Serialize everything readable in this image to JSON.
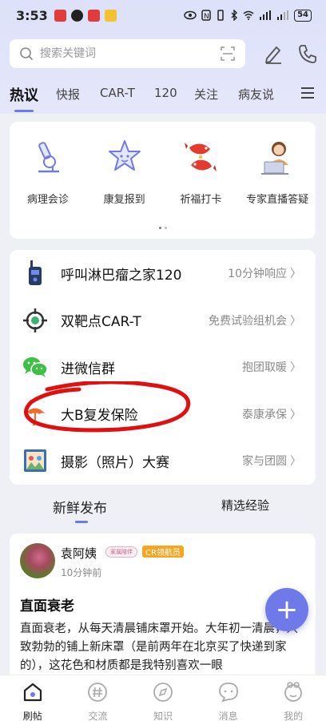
{
  "status_bar": {
    "time": "3:53",
    "battery": "54"
  },
  "search": {
    "placeholder": "搜索关键词"
  },
  "tabs": [
    {
      "label": "热议",
      "active": true
    },
    {
      "label": "快报"
    },
    {
      "label": "CAR-T"
    },
    {
      "label": "120"
    },
    {
      "label": "关注"
    },
    {
      "label": "病友说"
    }
  ],
  "quick_actions": [
    {
      "label": "病理会诊",
      "icon": "microscope-icon"
    },
    {
      "label": "康复报到",
      "icon": "star-face-icon"
    },
    {
      "label": "祈福打卡",
      "icon": "koi-fish-icon"
    },
    {
      "label": "专家直播答疑",
      "icon": "doctor-laptop-icon"
    }
  ],
  "service_list": [
    {
      "title": "呼叫淋巴瘤之家120",
      "subtitle": "10分钟响应",
      "icon": "walkie-talkie-icon"
    },
    {
      "title": "双靶点CAR-T",
      "subtitle": "免费试验组机会",
      "icon": "target-icon"
    },
    {
      "title": "进微信群",
      "subtitle": "抱团取暖",
      "icon": "wechat-icon"
    },
    {
      "title": "大B复发保险",
      "subtitle": "泰康承保",
      "icon": "umbrella-icon"
    },
    {
      "title": "摄影（照片）大赛",
      "subtitle": "家与团圆",
      "icon": "photo-frame-icon"
    }
  ],
  "sub_tabs": [
    {
      "label": "新鲜发布",
      "active": true
    },
    {
      "label": "精选经验"
    }
  ],
  "post": {
    "author": "袁阿姨",
    "badge_1": "家属陪伴",
    "badge_2": "CR领航员",
    "time": "10分钟前",
    "title": "直面衰老",
    "body": "直面衰老，从每天清晨铺床罩开始。大年初一清晨，兴致勃勃的铺上新床罩（是前两年在北京买了快递到家的），这花色和材质都是我特别喜欢一眼"
  },
  "bottom_nav": [
    {
      "label": "刷帖",
      "active": true,
      "icon": "home-icon"
    },
    {
      "label": "交流",
      "icon": "hashtag-icon"
    },
    {
      "label": "知识",
      "icon": "compass-icon"
    },
    {
      "label": "消息",
      "icon": "chat-icon"
    },
    {
      "label": "我的",
      "icon": "profile-icon"
    }
  ],
  "colors": {
    "accent": "#6f7ae8",
    "header_bg": "#dde1f9",
    "annotation_red": "#e01010"
  }
}
